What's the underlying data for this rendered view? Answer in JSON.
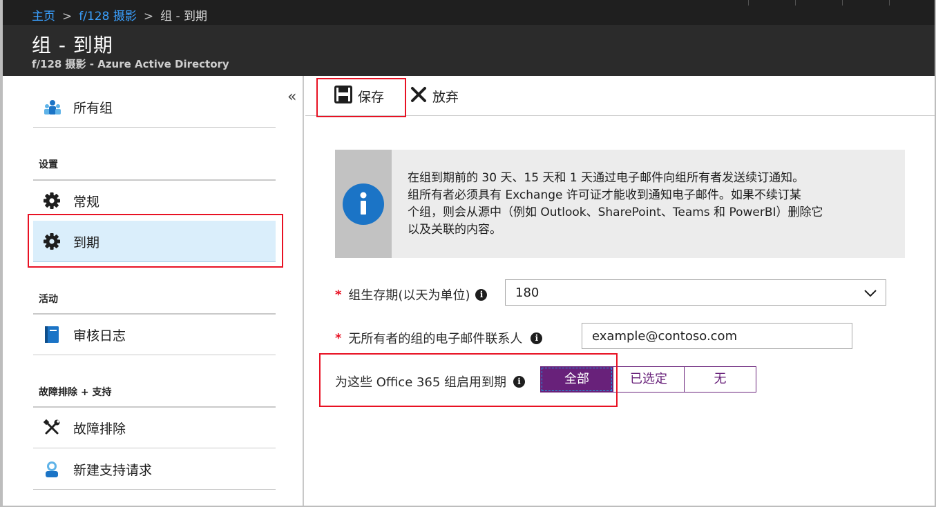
{
  "breadcrumb": {
    "home": "主页",
    "parent": "f/128 摄影",
    "current": "组 - 到期"
  },
  "header": {
    "title": "组 - 到期",
    "subtitle": "f/128 摄影 - Azure Active Directory"
  },
  "sidebar": {
    "collapse_glyph": "«",
    "all_groups": "所有组",
    "sections": {
      "settings": "设置",
      "activity": "活动",
      "troubleshoot": "故障排除 + 支持"
    },
    "items": {
      "general": "常规",
      "expiration": "到期",
      "audit_logs": "审核日志",
      "troubleshooting": "故障排除",
      "new_support_request": "新建支持请求"
    }
  },
  "toolbar": {
    "save_label": "保存",
    "discard_label": "放弃"
  },
  "info": {
    "line1": "在组到期前的 30 天、15 天和 1 天通过电子邮件向组所有者发送续订通知。",
    "line2": "组所有者必须具有 Exchange 许可证才能收到通知电子邮件。如果不续订某",
    "line3": "个组，则会从源中（例如 Outlook、SharePoint、Teams 和 PowerBI）删除它",
    "line4": "以及关联的内容。"
  },
  "form": {
    "lifetime_label": "组生存期(以天为单位)",
    "lifetime_value": "180",
    "email_label": "无所有者的组的电子邮件联系人",
    "email_value": "example@contoso.com",
    "enable_label": "为这些 Office 365 组启用到期",
    "options": [
      "全部",
      "已选定",
      "无"
    ],
    "selected_option": "全部"
  },
  "colors": {
    "accent_purple": "#68217a",
    "link_blue": "#3aa0ff",
    "info_blue": "#1b74c6",
    "highlight_red": "#e81123",
    "active_nav_bg": "#daeefb"
  }
}
